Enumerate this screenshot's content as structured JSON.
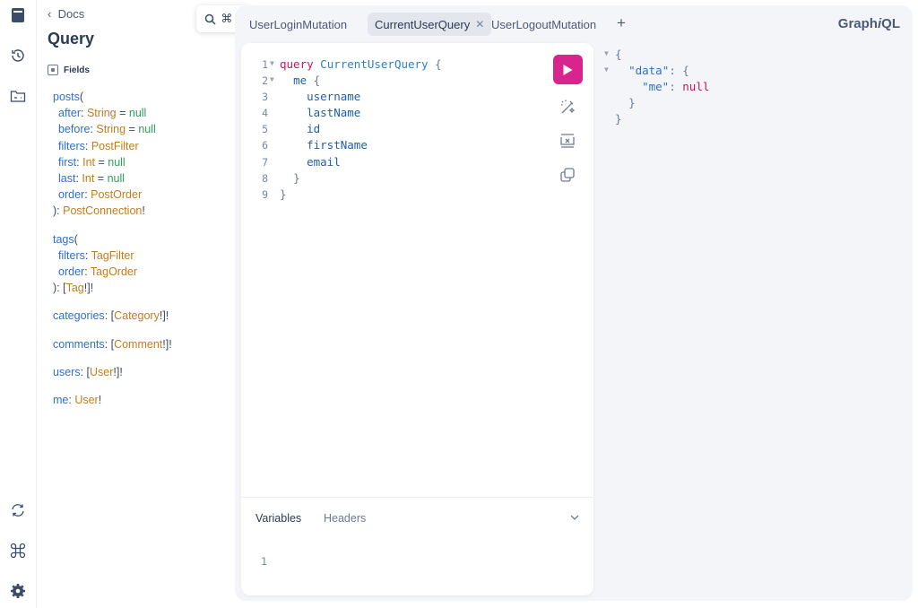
{
  "sidebar": {
    "icons": [
      "docs-icon",
      "history-icon",
      "explorer-icon",
      "refetch-schema-icon",
      "shortcuts-icon",
      "settings-icon"
    ]
  },
  "docs": {
    "back_label": "Docs",
    "title": "Query",
    "search_shortcut": "⌘ K",
    "fields_label": "Fields",
    "posts": {
      "name": "posts",
      "args": [
        {
          "name": "after",
          "type": "String",
          "default": "null"
        },
        {
          "name": "before",
          "type": "String",
          "default": "null"
        },
        {
          "name": "filters",
          "type": "PostFilter",
          "default": ""
        },
        {
          "name": "first",
          "type": "Int",
          "default": "null"
        },
        {
          "name": "last",
          "type": "Int",
          "default": "null"
        },
        {
          "name": "order",
          "type": "PostOrder",
          "default": ""
        }
      ],
      "return_type": "PostConnection"
    },
    "tags": {
      "name": "tags",
      "args": [
        {
          "name": "filters",
          "type": "TagFilter"
        },
        {
          "name": "order",
          "type": "TagOrder"
        }
      ],
      "return_type": "Tag"
    },
    "categories": {
      "name": "categories",
      "type": "Category"
    },
    "comments": {
      "name": "comments",
      "type": "Comment"
    },
    "users": {
      "name": "users",
      "type": "User"
    },
    "me": {
      "name": "me",
      "type": "User"
    }
  },
  "tabs": [
    {
      "label": "UserLoginMutation",
      "active": false
    },
    {
      "label": "CurrentUserQuery",
      "active": true
    },
    {
      "label": "UserLogoutMutation",
      "active": false
    }
  ],
  "add_tab_label": "+",
  "brand": {
    "prefix": "Graph",
    "italic": "i",
    "suffix": "QL"
  },
  "editor": {
    "line_numbers": [
      "1",
      "2",
      "3",
      "4",
      "5",
      "6",
      "7",
      "8",
      "9"
    ],
    "keyword": "query",
    "operation_name": "CurrentUserQuery",
    "root_field": "me",
    "fields": [
      "username",
      "lastName",
      "id",
      "firstName",
      "email"
    ]
  },
  "variables": {
    "tab_variables": "Variables",
    "tab_headers": "Headers",
    "line_number": "1"
  },
  "result": {
    "key_data": "\"data\"",
    "key_me": "\"me\"",
    "value_me": "null"
  },
  "colors": {
    "run_button": "#d8258e",
    "keyword": "#c2185b",
    "field": "#2f6fd0",
    "type": "#c27d1b",
    "default_value": "#2e9d5a"
  }
}
